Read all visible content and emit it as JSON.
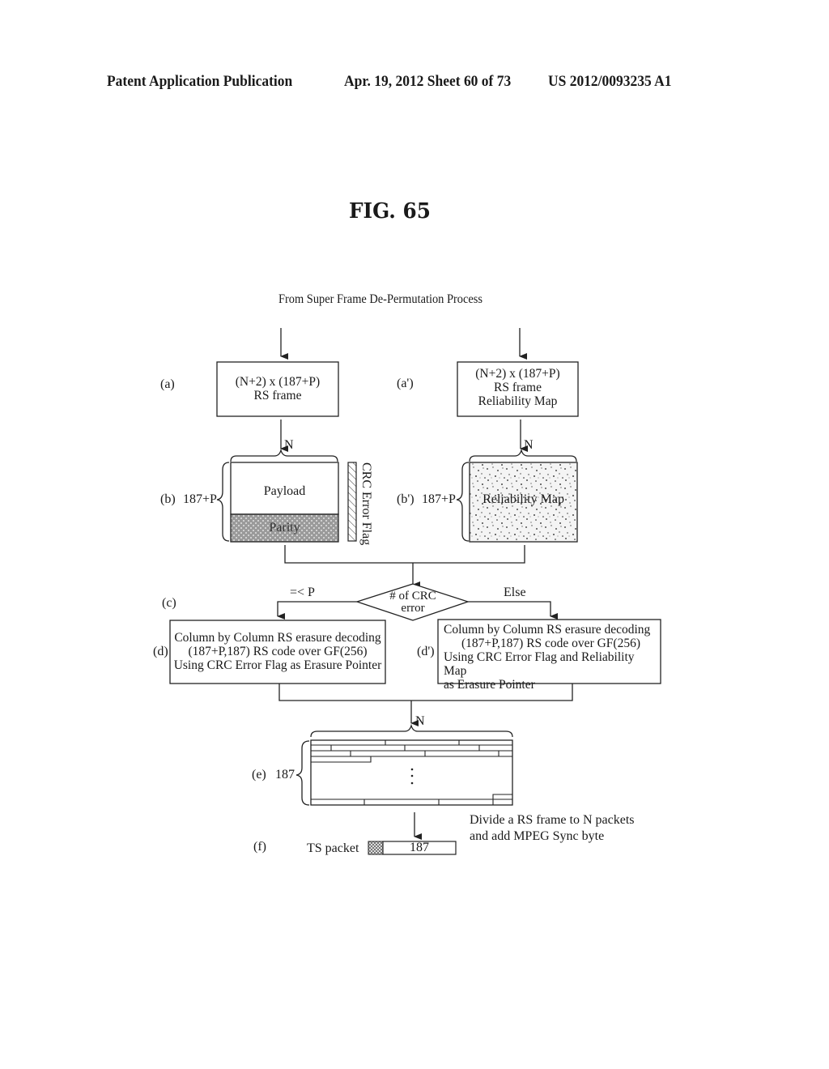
{
  "header": {
    "publication": "Patent Application Publication",
    "date_sheet": "Apr. 19, 2012  Sheet 60 of 73",
    "patent_number": "US 2012/0093235 A1"
  },
  "figure": {
    "title": "FIG. 65",
    "source_label": "From Super Frame De-Permutation Process",
    "steps": {
      "a": {
        "label": "(a)",
        "line1": "(N+2) x (187+P)",
        "line2": "RS frame"
      },
      "a_prime": {
        "label": "(a')",
        "line1": "(N+2) x (187+P)",
        "line2": "RS frame",
        "line3": "Reliability Map"
      },
      "b": {
        "label": "(b)",
        "rows": "187+P",
        "cols": "N",
        "payload": "Payload",
        "parity": "Parity",
        "flag": "CRC Error Flag"
      },
      "b_prime": {
        "label": "(b')",
        "rows": "187+P",
        "cols": "N",
        "content": "Reliability Map"
      },
      "c": {
        "label": "(c)",
        "decision_line1": "# of CRC",
        "decision_line2": "error",
        "left_branch": "=< P",
        "right_branch": "Else"
      },
      "d": {
        "label": "(d)",
        "line1": "Column by Column RS erasure decoding",
        "line2": "(187+P,187) RS code over GF(256)",
        "line3": "Using CRC Error Flag as Erasure Pointer"
      },
      "d_prime": {
        "label": "(d')",
        "line1": "Column by Column RS erasure decoding",
        "line2": "(187+P,187) RS code over GF(256)",
        "line3": "Using CRC Error Flag and Reliability Map",
        "line4": "as Erasure Pointer"
      },
      "e": {
        "label": "(e)",
        "rows": "187",
        "cols": "N",
        "ellipsis": "⋮"
      },
      "f": {
        "label": "(f)",
        "packet_label": "TS packet",
        "packet_size": "187",
        "note_line1": "Divide a RS frame to N packets",
        "note_line2": "and add MPEG Sync byte"
      }
    }
  }
}
